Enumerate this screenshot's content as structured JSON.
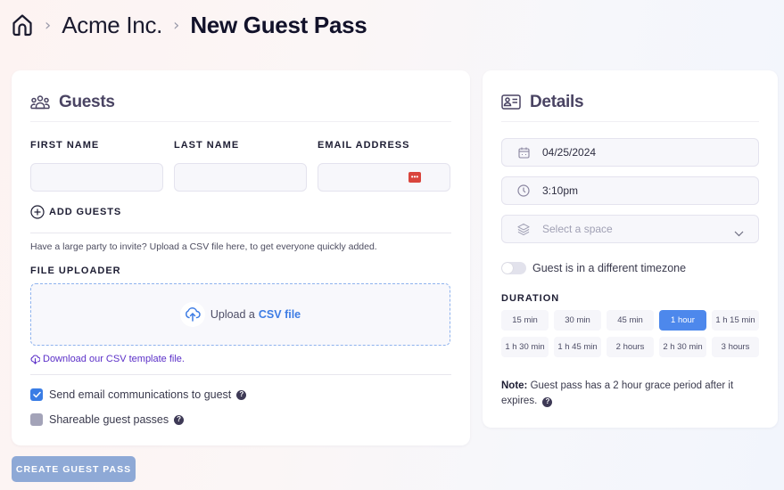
{
  "breadcrumb": {
    "home_icon": "home-icon",
    "separator": "›",
    "items": [
      "Acme Inc."
    ],
    "current": "New Guest Pass"
  },
  "guests_card": {
    "title": "Guests",
    "icon": "users-icon",
    "fields": [
      {
        "label": "FIRST NAME",
        "value": "",
        "placeholder": ""
      },
      {
        "label": "LAST NAME",
        "value": "",
        "placeholder": ""
      },
      {
        "label": "EMAIL ADDRESS",
        "value": "",
        "placeholder": ""
      }
    ],
    "add_guests_label": "ADD GUESTS",
    "helper_text": "Have a large party to invite? Upload a CSV file here, to get everyone quickly added.",
    "file_uploader_label": "FILE UPLOADER",
    "upload_text": "Upload a",
    "upload_link": "CSV file",
    "download_link": "Download our CSV template file.",
    "checkboxes": [
      {
        "label": "Send email communications to guest",
        "checked": true
      },
      {
        "label": "Shareable guest passes",
        "checked": false
      }
    ]
  },
  "details_card": {
    "title": "Details",
    "icon": "id-card-icon",
    "date": "04/25/2024",
    "time": "3:10pm",
    "space_placeholder": "Select a space",
    "timezone_toggle_label": "Guest is in a different timezone",
    "timezone_toggle_on": false,
    "duration_label": "DURATION",
    "durations": [
      "15 min",
      "30 min",
      "45 min",
      "1 hour",
      "1 h 15 min",
      "1 h 30 min",
      "1 h 45 min",
      "2 hours",
      "2 h 30 min",
      "3 hours"
    ],
    "selected_duration": "1 hour",
    "note_label": "Note:",
    "note_text": "Guest pass has a 2 hour grace period after it expires."
  },
  "actions": {
    "create_label": "CREATE GUEST PASS"
  },
  "colors": {
    "accent": "#4d88ec",
    "link": "#3d7ce4",
    "download_link": "#5b2fc8",
    "create_button_disabled": "#8ea9d6",
    "password_badge": "#d9453d"
  }
}
